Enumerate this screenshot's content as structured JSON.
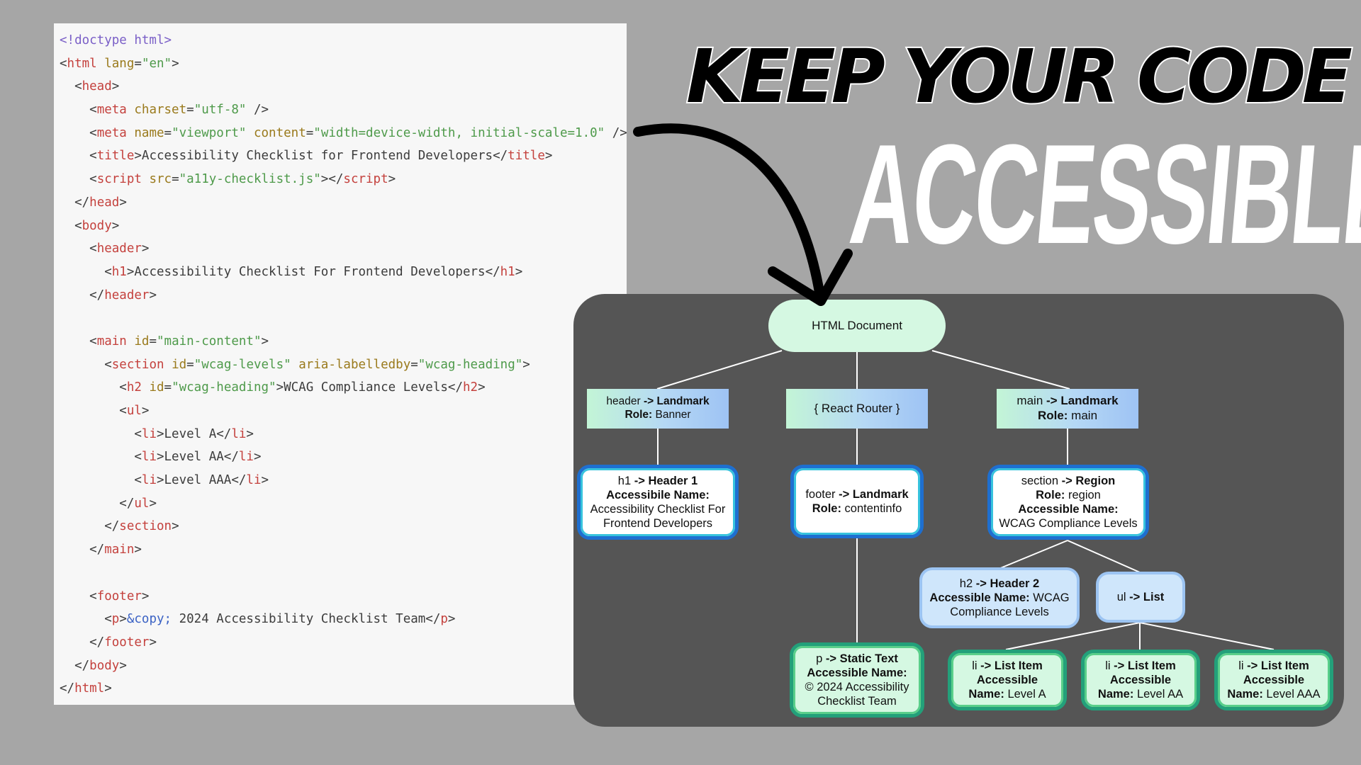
{
  "code_lines": [
    [
      {
        "t": "<!doctype ",
        "c": "kw"
      },
      {
        "t": "html",
        "c": "kw"
      },
      {
        "t": ">",
        "c": "kw"
      }
    ],
    [
      {
        "t": "<",
        "c": "punc"
      },
      {
        "t": "html",
        "c": "tag"
      },
      {
        "t": " lang",
        "c": "attr"
      },
      {
        "t": "=",
        "c": "punc"
      },
      {
        "t": "\"en\"",
        "c": "str"
      },
      {
        "t": ">",
        "c": "punc"
      }
    ],
    [
      {
        "t": "  <",
        "c": "punc"
      },
      {
        "t": "head",
        "c": "tag"
      },
      {
        "t": ">",
        "c": "punc"
      }
    ],
    [
      {
        "t": "    <",
        "c": "punc"
      },
      {
        "t": "meta",
        "c": "tag"
      },
      {
        "t": " charset",
        "c": "attr"
      },
      {
        "t": "=",
        "c": "punc"
      },
      {
        "t": "\"utf-8\"",
        "c": "str"
      },
      {
        "t": " />",
        "c": "punc"
      }
    ],
    [
      {
        "t": "    <",
        "c": "punc"
      },
      {
        "t": "meta",
        "c": "tag"
      },
      {
        "t": " name",
        "c": "attr"
      },
      {
        "t": "=",
        "c": "punc"
      },
      {
        "t": "\"viewport\"",
        "c": "str"
      },
      {
        "t": " content",
        "c": "attr"
      },
      {
        "t": "=",
        "c": "punc"
      },
      {
        "t": "\"width=device-width, initial-scale=1.0\"",
        "c": "str"
      },
      {
        "t": " />",
        "c": "punc"
      }
    ],
    [
      {
        "t": "    <",
        "c": "punc"
      },
      {
        "t": "title",
        "c": "tag"
      },
      {
        "t": ">Accessibility Checklist for Frontend Developers</",
        "c": "punc"
      },
      {
        "t": "title",
        "c": "tag"
      },
      {
        "t": ">",
        "c": "punc"
      }
    ],
    [
      {
        "t": "    <",
        "c": "punc"
      },
      {
        "t": "script",
        "c": "tag"
      },
      {
        "t": " src",
        "c": "attr"
      },
      {
        "t": "=",
        "c": "punc"
      },
      {
        "t": "\"a11y-checklist.js\"",
        "c": "str"
      },
      {
        "t": "></",
        "c": "punc"
      },
      {
        "t": "script",
        "c": "tag"
      },
      {
        "t": ">",
        "c": "punc"
      }
    ],
    [
      {
        "t": "  </",
        "c": "punc"
      },
      {
        "t": "head",
        "c": "tag"
      },
      {
        "t": ">",
        "c": "punc"
      }
    ],
    [
      {
        "t": "  <",
        "c": "punc"
      },
      {
        "t": "body",
        "c": "tag"
      },
      {
        "t": ">",
        "c": "punc"
      }
    ],
    [
      {
        "t": "    <",
        "c": "punc"
      },
      {
        "t": "header",
        "c": "tag"
      },
      {
        "t": ">",
        "c": "punc"
      }
    ],
    [
      {
        "t": "      <",
        "c": "punc"
      },
      {
        "t": "h1",
        "c": "tag"
      },
      {
        "t": ">Accessibility Checklist For Frontend Developers</",
        "c": "punc"
      },
      {
        "t": "h1",
        "c": "tag"
      },
      {
        "t": ">",
        "c": "punc"
      }
    ],
    [
      {
        "t": "    </",
        "c": "punc"
      },
      {
        "t": "header",
        "c": "tag"
      },
      {
        "t": ">",
        "c": "punc"
      }
    ],
    [],
    [
      {
        "t": "    <",
        "c": "punc"
      },
      {
        "t": "main",
        "c": "tag"
      },
      {
        "t": " id",
        "c": "attr"
      },
      {
        "t": "=",
        "c": "punc"
      },
      {
        "t": "\"main-content\"",
        "c": "str"
      },
      {
        "t": ">",
        "c": "punc"
      }
    ],
    [
      {
        "t": "      <",
        "c": "punc"
      },
      {
        "t": "section",
        "c": "tag"
      },
      {
        "t": " id",
        "c": "attr"
      },
      {
        "t": "=",
        "c": "punc"
      },
      {
        "t": "\"wcag-levels\"",
        "c": "str"
      },
      {
        "t": " aria-labelledby",
        "c": "attr"
      },
      {
        "t": "=",
        "c": "punc"
      },
      {
        "t": "\"wcag-heading\"",
        "c": "str"
      },
      {
        "t": ">",
        "c": "punc"
      }
    ],
    [
      {
        "t": "        <",
        "c": "punc"
      },
      {
        "t": "h2",
        "c": "tag"
      },
      {
        "t": " id",
        "c": "attr"
      },
      {
        "t": "=",
        "c": "punc"
      },
      {
        "t": "\"wcag-heading\"",
        "c": "str"
      },
      {
        "t": ">WCAG Compliance Levels</",
        "c": "punc"
      },
      {
        "t": "h2",
        "c": "tag"
      },
      {
        "t": ">",
        "c": "punc"
      }
    ],
    [
      {
        "t": "        <",
        "c": "punc"
      },
      {
        "t": "ul",
        "c": "tag"
      },
      {
        "t": ">",
        "c": "punc"
      }
    ],
    [
      {
        "t": "          <",
        "c": "punc"
      },
      {
        "t": "li",
        "c": "tag"
      },
      {
        "t": ">Level A</",
        "c": "punc"
      },
      {
        "t": "li",
        "c": "tag"
      },
      {
        "t": ">",
        "c": "punc"
      }
    ],
    [
      {
        "t": "          <",
        "c": "punc"
      },
      {
        "t": "li",
        "c": "tag"
      },
      {
        "t": ">Level AA</",
        "c": "punc"
      },
      {
        "t": "li",
        "c": "tag"
      },
      {
        "t": ">",
        "c": "punc"
      }
    ],
    [
      {
        "t": "          <",
        "c": "punc"
      },
      {
        "t": "li",
        "c": "tag"
      },
      {
        "t": ">Level AAA</",
        "c": "punc"
      },
      {
        "t": "li",
        "c": "tag"
      },
      {
        "t": ">",
        "c": "punc"
      }
    ],
    [
      {
        "t": "        </",
        "c": "punc"
      },
      {
        "t": "ul",
        "c": "tag"
      },
      {
        "t": ">",
        "c": "punc"
      }
    ],
    [
      {
        "t": "      </",
        "c": "punc"
      },
      {
        "t": "section",
        "c": "tag"
      },
      {
        "t": ">",
        "c": "punc"
      }
    ],
    [
      {
        "t": "    </",
        "c": "punc"
      },
      {
        "t": "main",
        "c": "tag"
      },
      {
        "t": ">",
        "c": "punc"
      }
    ],
    [],
    [
      {
        "t": "    <",
        "c": "punc"
      },
      {
        "t": "footer",
        "c": "tag"
      },
      {
        "t": ">",
        "c": "punc"
      }
    ],
    [
      {
        "t": "      <",
        "c": "punc"
      },
      {
        "t": "p",
        "c": "tag"
      },
      {
        "t": ">",
        "c": "punc"
      },
      {
        "t": "&copy;",
        "c": "ent"
      },
      {
        "t": " 2024 Accessibility Checklist Team</",
        "c": "punc"
      },
      {
        "t": "p",
        "c": "tag"
      },
      {
        "t": ">",
        "c": "punc"
      }
    ],
    [
      {
        "t": "    </",
        "c": "punc"
      },
      {
        "t": "footer",
        "c": "tag"
      },
      {
        "t": ">",
        "c": "punc"
      }
    ],
    [
      {
        "t": "  </",
        "c": "punc"
      },
      {
        "t": "body",
        "c": "tag"
      },
      {
        "t": ">",
        "c": "punc"
      }
    ],
    [
      {
        "t": "</",
        "c": "punc"
      },
      {
        "t": "html",
        "c": "tag"
      },
      {
        "t": ">",
        "c": "punc"
      }
    ]
  ],
  "headline": {
    "line1": "KEEP YOUR CODE",
    "line2": "ACCESSIBLE"
  },
  "tree": {
    "root": {
      "label": "HTML Document"
    },
    "header_landmark": {
      "tag": "header",
      "arrow": " -> ",
      "role_name": "Landmark",
      "role_label": "Role:",
      "role": " Banner"
    },
    "react_router": {
      "label": "{ React Router }"
    },
    "main_landmark": {
      "tag": "main",
      "arrow": " -> ",
      "role_name": "Landmark",
      "role_label": "Role:",
      "role": " main"
    },
    "h1": {
      "tag": "h1",
      "arrow": " -> ",
      "role_name": "Header 1",
      "name_label": "Accessibile Name:",
      "name": "Accessibility Checklist For Frontend Developers"
    },
    "footer": {
      "tag": "footer",
      "arrow": " -> ",
      "role_name": "Landmark",
      "role_label": "Role:",
      "role": " contentinfo"
    },
    "section": {
      "tag": "section",
      "arrow": " -> ",
      "role_name": "Region",
      "role_label": "Role:",
      "role": " region",
      "name_label": "Accessible Name:",
      "name": "WCAG Compliance Levels"
    },
    "h2": {
      "tag": "h2",
      "arrow": " -> ",
      "role_name": "Header 2",
      "name_label": "Accessible Name:",
      "name_inline": " WCAG",
      "name_rest": "Compliance Levels"
    },
    "ul": {
      "tag": "ul",
      "arrow": " -> ",
      "role_name": "List"
    },
    "p": {
      "tag": "p",
      "arrow": " -> ",
      "role_name": "Static Text",
      "name_label": "Accessible Name:",
      "name": "© 2024 Accessibility Checklist Team"
    },
    "li_items": [
      {
        "tag": "li",
        "arrow": " -> ",
        "role_name": "List Item",
        "name_label_1": "Accessible",
        "name_label_2": "Name:",
        "name": " Level A"
      },
      {
        "tag": "li",
        "arrow": " -> ",
        "role_name": "List Item",
        "name_label_1": "Accessible",
        "name_label_2": "Name:",
        "name": " Level AA"
      },
      {
        "tag": "li",
        "arrow": " -> ",
        "role_name": "List Item",
        "name_label_1": "Accessible",
        "name_label_2": "Name:",
        "name": " Level AAA"
      }
    ]
  },
  "colors": {
    "page_background": "#a6a6a6",
    "code_background": "#f7f7f7",
    "diagram_background": "#555555",
    "code_tag": "#c4413d",
    "code_attribute": "#9a7a1c",
    "code_string": "#4e9a4a",
    "code_doctype": "#7a5fc7",
    "node_border_blue": "#1e6fd0",
    "node_border_green": "#23a07a"
  },
  "icons": {
    "arrow": "curved-arrow-icon"
  }
}
